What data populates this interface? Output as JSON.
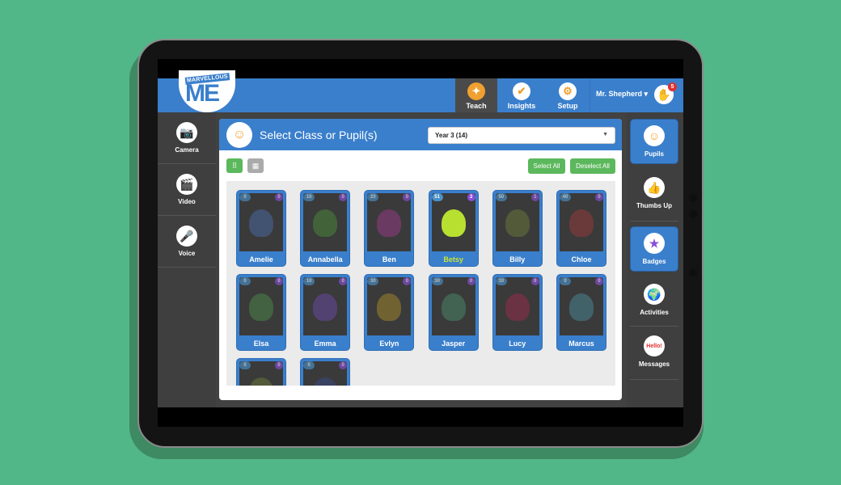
{
  "app": {
    "logo_small": "MARVELLOUS",
    "logo_big": "ME"
  },
  "nav": {
    "items": [
      {
        "label": "Teach",
        "icon": "teach-star-icon",
        "active": true
      },
      {
        "label": "Insights",
        "icon": "checkmark-icon",
        "active": false
      },
      {
        "label": "Setup",
        "icon": "gear-icon",
        "active": false
      }
    ],
    "user_name": "Mr. Shepherd",
    "user_caret": "▾",
    "notifications": "5"
  },
  "left_tools": [
    {
      "label": "Camera",
      "icon": "camera-icon"
    },
    {
      "label": "Video",
      "icon": "video-clapper-icon"
    },
    {
      "label": "Voice",
      "icon": "microphone-icon"
    }
  ],
  "right_tools": [
    {
      "label": "Pupils",
      "icon": "pupils-icon",
      "active": true
    },
    {
      "label": "Thumbs Up",
      "icon": "thumbs-up-icon",
      "active": false
    },
    {
      "label": "Badges",
      "icon": "badge-star-icon",
      "active": true
    },
    {
      "label": "Activities",
      "icon": "globe-icon",
      "active": false
    },
    {
      "label": "Messages",
      "icon": "hello-speech-icon",
      "active": false
    }
  ],
  "panel": {
    "title": "Select Class or Pupil(s)",
    "class_selected": "Year 3 (14)",
    "select_all": "Select All",
    "deselect_all": "Deselect All"
  },
  "pupils": [
    {
      "name": "Amelie",
      "points": "0",
      "badges": "0",
      "selected": false,
      "color": "#4a6aa8"
    },
    {
      "name": "Annabella",
      "points": "10",
      "badges": "0",
      "selected": false,
      "color": "#4a8a3a"
    },
    {
      "name": "Ben",
      "points": "20",
      "badges": "0",
      "selected": false,
      "color": "#9a3a8a"
    },
    {
      "name": "Betsy",
      "points": "51",
      "badges": "3",
      "selected": true,
      "color": "#b8e030"
    },
    {
      "name": "Billy",
      "points": "50",
      "badges": "1",
      "selected": false,
      "color": "#6a7a3a"
    },
    {
      "name": "Chloe",
      "points": "40",
      "badges": "0",
      "selected": false,
      "color": "#9a3a3a"
    },
    {
      "name": "Elsa",
      "points": "0",
      "badges": "0",
      "selected": false,
      "color": "#4a8a4a"
    },
    {
      "name": "Emma",
      "points": "10",
      "badges": "0",
      "selected": false,
      "color": "#6a4aa8"
    },
    {
      "name": "Evlyn",
      "points": "30",
      "badges": "0",
      "selected": false,
      "color": "#a88a2a"
    },
    {
      "name": "Jasper",
      "points": "30",
      "badges": "0",
      "selected": false,
      "color": "#4a8a6a"
    },
    {
      "name": "Lucy",
      "points": "10",
      "badges": "0",
      "selected": false,
      "color": "#9a2a4a"
    },
    {
      "name": "Marcus",
      "points": "0",
      "badges": "0",
      "selected": false,
      "color": "#4a8a9a"
    },
    {
      "name": "",
      "points": "0",
      "badges": "0",
      "selected": false,
      "color": "#6a7a3a"
    },
    {
      "name": "",
      "points": "0",
      "badges": "0",
      "selected": false,
      "color": "#3a4a8a"
    }
  ]
}
